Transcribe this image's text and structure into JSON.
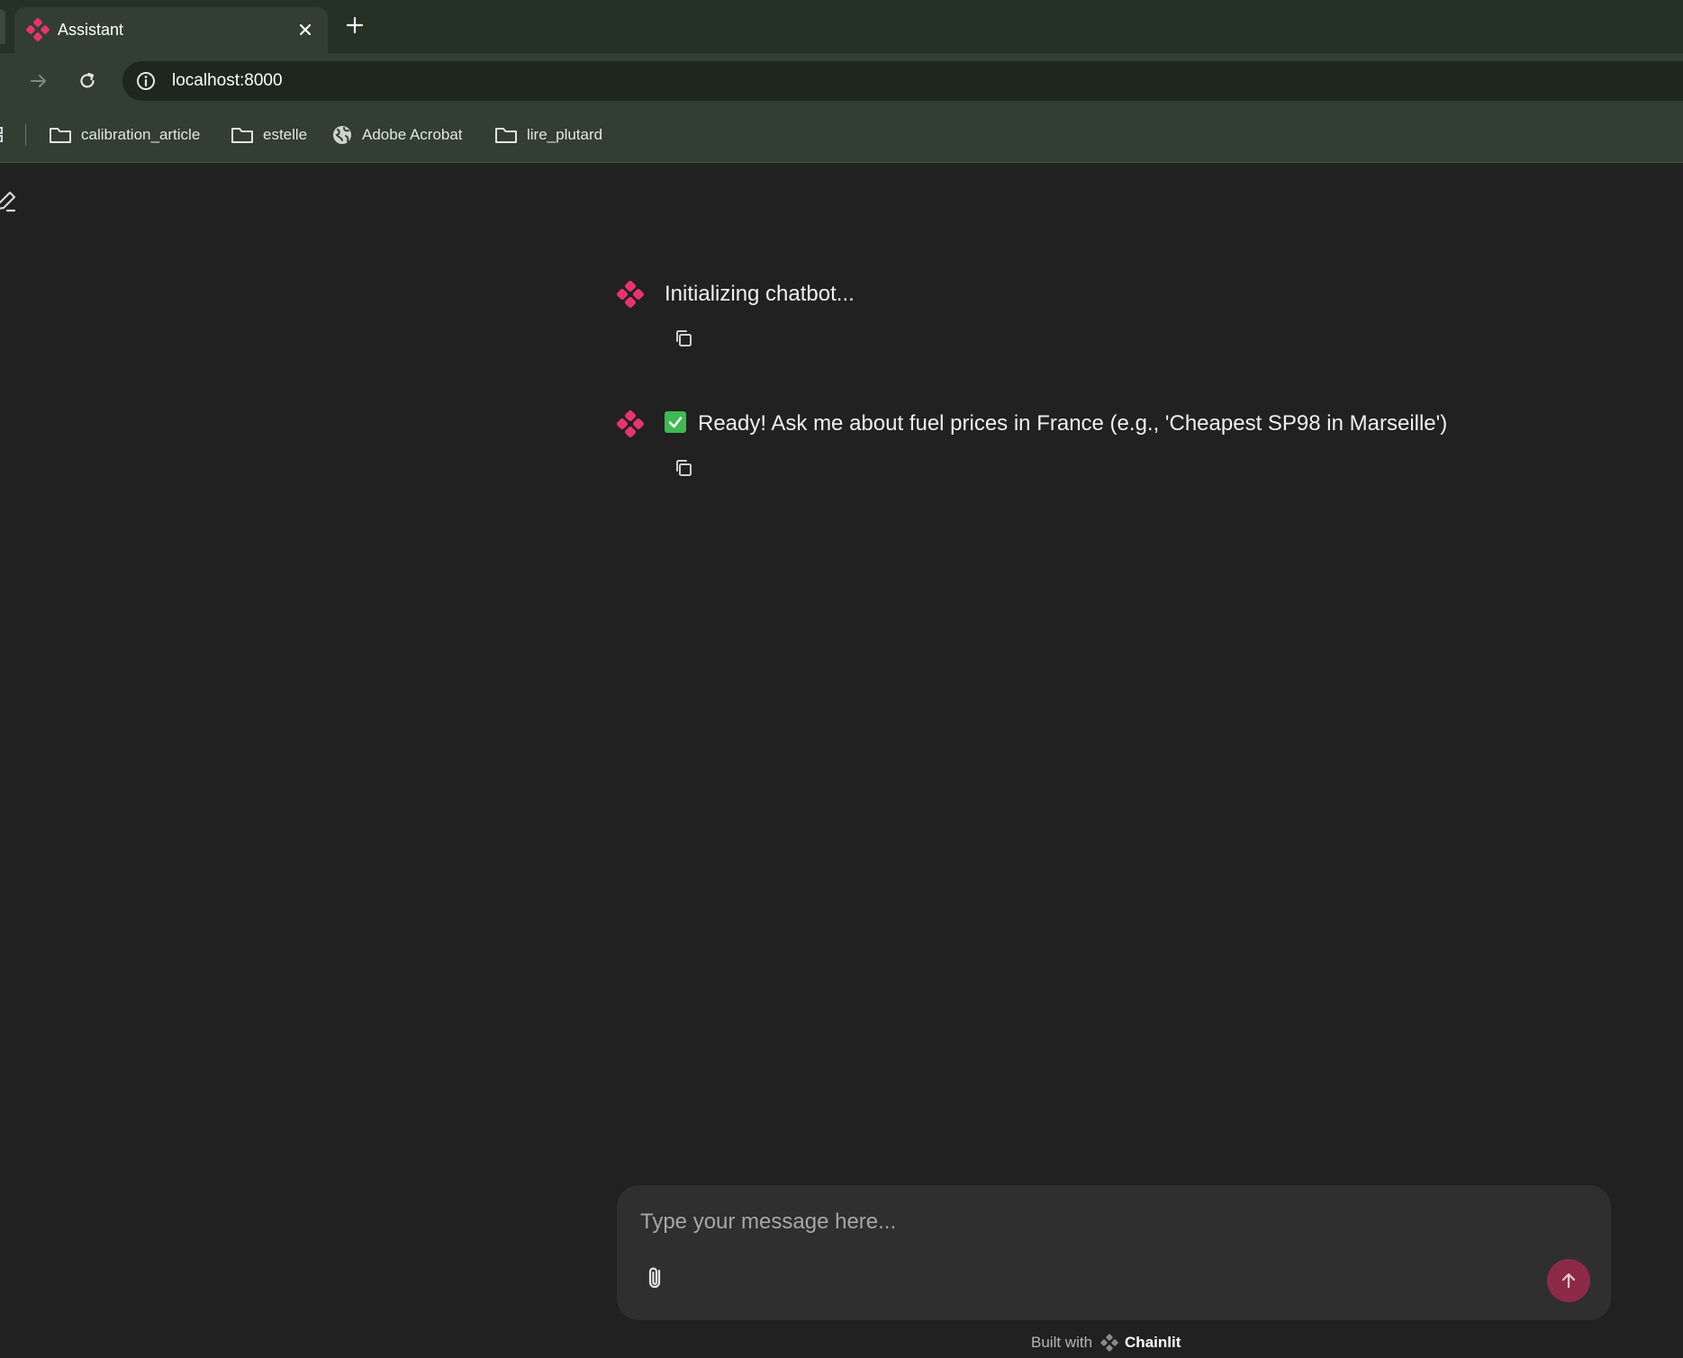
{
  "browser": {
    "tab": {
      "title": "Assistant",
      "favicon": "chainlit-logo-icon"
    },
    "address": {
      "url": "localhost:8000"
    },
    "bookmarks": [
      {
        "label": "calibration_article",
        "icon": "folder-icon"
      },
      {
        "label": "estelle",
        "icon": "folder-icon"
      },
      {
        "label": "Adobe Acrobat",
        "icon": "globe-icon"
      },
      {
        "label": "lire_plutard",
        "icon": "folder-icon"
      }
    ]
  },
  "chat": {
    "messages": [
      {
        "text": "Initializing chatbot..."
      },
      {
        "emoji": "check-mark-button",
        "text": "Ready! Ask me about fuel prices in France (e.g., 'Cheapest SP98 in Marseille')"
      }
    ]
  },
  "composer": {
    "placeholder": "Type your message here..."
  },
  "footer": {
    "prefix": "Built with",
    "brand": "Chainlit"
  },
  "colors": {
    "accent": "#e8336f",
    "send_button": "#8e2a49",
    "background": "#212121",
    "composer": "#2f2f2f",
    "check": "#3fb950"
  }
}
